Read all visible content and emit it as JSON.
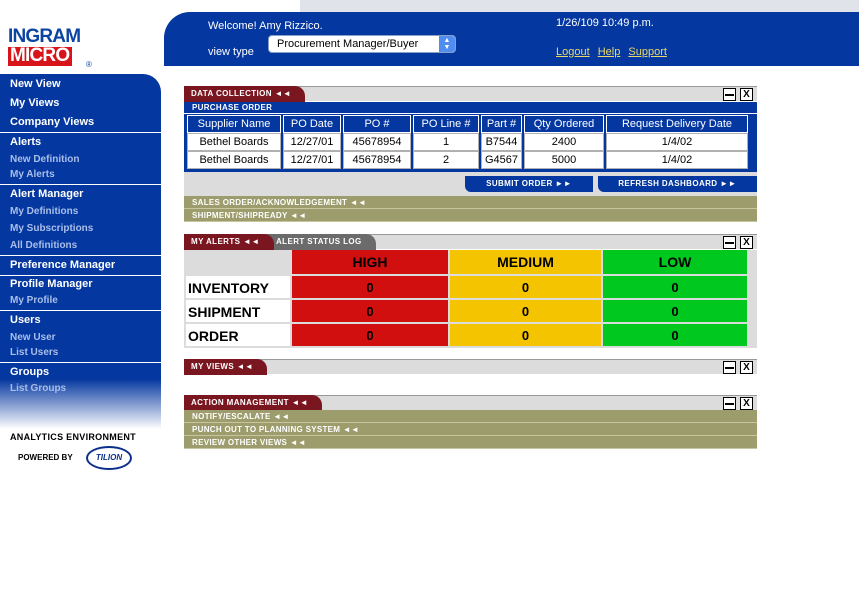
{
  "brand": {
    "line1": "INGRAM",
    "line2": "MICRO",
    "reg": "®"
  },
  "header": {
    "welcome": "Welcome! Amy Rizzico.",
    "datetime": "1/26/109 10:49 p.m.",
    "view_type_label": "view type",
    "view_type_value": "Procurement Manager/Buyer",
    "links": [
      "Logout",
      "Help",
      "Support"
    ]
  },
  "sidebar": {
    "sections": [
      {
        "title": "New View",
        "items": []
      },
      {
        "title": "My Views",
        "items": []
      },
      {
        "title": "Company Views",
        "items": []
      },
      {
        "title": "Alerts",
        "items": [
          "New Definition",
          "My Alerts"
        ]
      },
      {
        "title": "Alert Manager",
        "items": [
          "My Definitions",
          "My Subscriptions",
          "All Definitions"
        ]
      },
      {
        "title": "Preference Manager",
        "items": []
      },
      {
        "title": "Profile Manager",
        "items": [
          "My Profile"
        ]
      },
      {
        "title": "Users",
        "items": [
          "New User",
          "List Users"
        ]
      },
      {
        "title": "Groups",
        "items": [
          "List Groups"
        ]
      }
    ],
    "footer_env": "ANALYTICS ENVIRONMENT",
    "footer_powered": "POWERED BY",
    "footer_logo": "TILION"
  },
  "data_collection": {
    "tab": "DATA COLLECTION ◄◄",
    "sub": "PURCHASE ORDER",
    "columns": [
      "Supplier Name",
      "PO Date",
      "PO #",
      "PO Line #",
      "Part #",
      "Qty Ordered",
      "Request Delivery Date"
    ],
    "rows": [
      [
        "Bethel Boards",
        "12/27/01",
        "45678954",
        "1",
        "B7544",
        "2400",
        "1/4/02"
      ],
      [
        "Bethel Boards",
        "12/27/01",
        "45678954",
        "2",
        "G4567",
        "5000",
        "1/4/02"
      ]
    ],
    "submit": "SUBMIT ORDER ►►",
    "refresh": "REFRESH DASHBOARD ►►",
    "collapsed": [
      "SALES ORDER/ACKNOWLEDGEMENT ◄◄",
      "SHIPMENT/SHIPREADY ◄◄"
    ]
  },
  "alerts": {
    "tab": "MY ALERTS ◄◄",
    "tab2": "ALERT STATUS LOG",
    "levels": [
      "HIGH",
      "MEDIUM",
      "LOW"
    ],
    "rows": [
      {
        "label": "INVENTORY",
        "values": [
          "0",
          "0",
          "0"
        ]
      },
      {
        "label": "SHIPMENT",
        "values": [
          "0",
          "0",
          "0"
        ]
      },
      {
        "label": "ORDER",
        "values": [
          "0",
          "0",
          "0"
        ]
      }
    ],
    "colors": {
      "high": "#d20f0f",
      "medium": "#f5c400",
      "low": "#00c81e"
    }
  },
  "my_views": {
    "tab": "MY VIEWS ◄◄"
  },
  "action_management": {
    "tab": "ACTION MANAGEMENT ◄◄",
    "items": [
      "NOTIFY/ESCALATE ◄◄",
      "PUNCH OUT TO PLANNING SYSTEM ◄◄",
      "REVIEW OTHER VIEWS ◄◄"
    ]
  },
  "window_controls": {
    "close": "X"
  }
}
